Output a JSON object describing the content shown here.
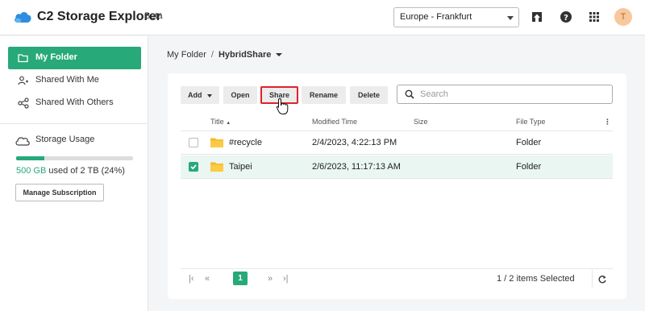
{
  "header": {
    "title": "C2 Storage Explorer",
    "badge": "Beta",
    "region": "Europe - Frankfurt",
    "avatar_initial": "T",
    "icons": [
      "upload-icon",
      "help-icon",
      "apps-grid-icon"
    ]
  },
  "sidebar": {
    "items": [
      {
        "label": "My Folder",
        "icon": "folder-icon",
        "active": true
      },
      {
        "label": "Shared With Me",
        "icon": "people-icon",
        "active": false
      },
      {
        "label": "Shared With Others",
        "icon": "share-icon",
        "active": false
      }
    ],
    "storage": {
      "title": "Storage Usage",
      "used": "500 GB",
      "used_suffix": "used of 2 TB (24%)",
      "percent": 24,
      "manage_label": "Manage Subscription"
    }
  },
  "breadcrumb": {
    "root": "My Folder",
    "separator": "/",
    "current": "HybridShare"
  },
  "toolbar": {
    "add": "Add",
    "open": "Open",
    "share": "Share",
    "rename": "Rename",
    "delete": "Delete",
    "search_placeholder": "Search"
  },
  "table": {
    "columns": {
      "title": "Title",
      "title_sort": "▲",
      "modified": "Modified Time",
      "size": "Size",
      "type": "File Type",
      "menu": "⋮"
    },
    "rows": [
      {
        "name": "#recycle",
        "modified": "2/4/2023, 4:22:13 PM",
        "size": "",
        "type": "Folder",
        "selected": false
      },
      {
        "name": "Taipei",
        "modified": "2/6/2023, 11:17:13 AM",
        "size": "",
        "type": "Folder",
        "selected": true
      }
    ]
  },
  "pagination": {
    "first": "|‹",
    "prev": "«",
    "page": "1",
    "next": "»",
    "last": "›|",
    "selection": "1 / 2 items Selected"
  },
  "colors": {
    "accent": "#27a97a",
    "highlight": "#e0222a"
  }
}
